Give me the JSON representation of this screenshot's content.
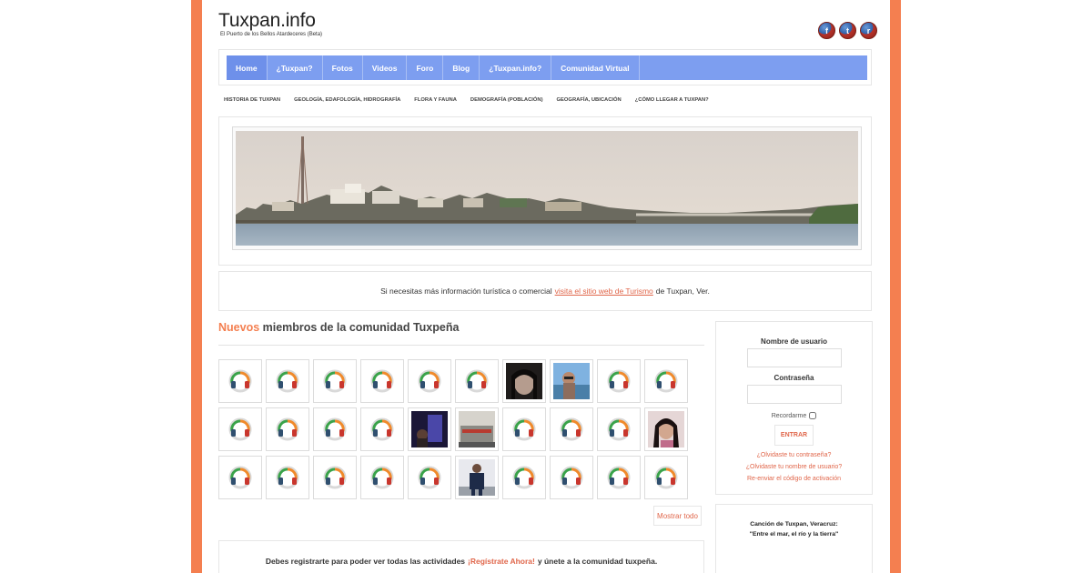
{
  "site": {
    "title": "Tuxpan.info",
    "tagline": "El Puerto de los Bellos Atardeceres (Beta)"
  },
  "social": [
    {
      "icon": "facebook-icon",
      "glyph": "f"
    },
    {
      "icon": "twitter-icon",
      "glyph": "t"
    },
    {
      "icon": "rss-icon",
      "glyph": "r"
    }
  ],
  "nav": {
    "items": [
      "Home",
      "¿Tuxpan?",
      "Fotos",
      "Videos",
      "Foro",
      "Blog",
      "¿Tuxpan.info?",
      "Comunidad Virtual"
    ]
  },
  "subnav": {
    "items": [
      "HISTORIA DE TUXPAN",
      "GEOLOGÍA, EDAFOLOGÍA, HIDROGRAFÍA",
      "FLORA Y FAUNA",
      "DEMOGRAFÍA (POBLACIÓN)",
      "GEOGRAFÍA, UBICACIÓN",
      "¿CÓMO LLEGAR A TUXPAN?"
    ]
  },
  "info": {
    "text_before": "Si necesitas más información turística o comercial",
    "link": "visita el sitio web de Turismo",
    "text_after": "de Tuxpan, Ver."
  },
  "members": {
    "title_highlight": "Nuevos",
    "title_rest": "miembros de la comunidad Tuxpeña",
    "cells": [
      "default",
      "default",
      "default",
      "default",
      "default",
      "default",
      "photo-woman",
      "photo-man-sea",
      "default",
      "default",
      "default",
      "default",
      "default",
      "default",
      "photo-night",
      "photo-building",
      "default",
      "default",
      "default",
      "photo-girl",
      "default",
      "default",
      "default",
      "default",
      "default",
      "photo-man-suit",
      "default",
      "default",
      "default",
      "default"
    ],
    "show_all": "Mostrar todo"
  },
  "register": {
    "before": "Debes registrarte para poder ver todas las actividades",
    "link": "¡Regístrate Ahora!",
    "after": "y únete a la comunidad tuxpeña."
  },
  "login": {
    "username_label": "Nombre de usuario",
    "password_label": "Contraseña",
    "remember_label": "Recordarme",
    "submit": "ENTRAR",
    "forgot_password": "¿Olvidaste tu contraseña?",
    "forgot_username": "¿Olvidaste tu nombre de usuario?",
    "resend": "Re-enviar el código de activación"
  },
  "song": {
    "line1": "Canción de Tuxpan, Veracruz:",
    "line2": "\"Entre el mar, el río y la tierra\""
  },
  "colors": {
    "accent": "#f47f50",
    "nav": "#7d9ef0",
    "link": "#e0664a"
  }
}
